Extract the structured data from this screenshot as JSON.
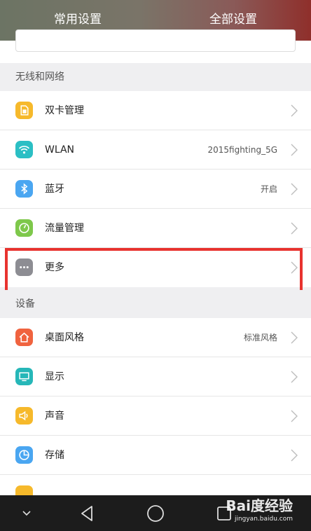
{
  "header": {
    "tabs": [
      {
        "label": "常用设置",
        "selected": false
      },
      {
        "label": "全部设置",
        "selected": true
      }
    ]
  },
  "sections": {
    "wireless": {
      "title": "无线和网络",
      "items": [
        {
          "label": "双卡管理",
          "value": "",
          "icon": "sim-card-icon",
          "color": "#f6b92b"
        },
        {
          "label": "WLAN",
          "value": "2015fighting_5G",
          "icon": "wifi-icon",
          "color": "#2bbfc4"
        },
        {
          "label": "蓝牙",
          "value": "开启",
          "icon": "bluetooth-icon",
          "color": "#4aa6f1"
        },
        {
          "label": "流量管理",
          "value": "",
          "icon": "data-usage-icon",
          "color": "#7ec84b"
        },
        {
          "label": "更多",
          "value": "",
          "icon": "more-icon",
          "color": "#8d8d93"
        }
      ]
    },
    "device": {
      "title": "设备",
      "items": [
        {
          "label": "桌面风格",
          "value": "标准风格",
          "icon": "home-icon",
          "color": "#f0633f"
        },
        {
          "label": "显示",
          "value": "",
          "icon": "display-icon",
          "color": "#26b7b8"
        },
        {
          "label": "声音",
          "value": "",
          "icon": "speaker-icon",
          "color": "#f6b92b"
        },
        {
          "label": "存储",
          "value": "",
          "icon": "storage-icon",
          "color": "#4aa6f1"
        }
      ]
    }
  },
  "highlight_color": "#e8332f",
  "watermark": {
    "logo": "Bai度经验",
    "url": "jingyan.baidu.com"
  }
}
